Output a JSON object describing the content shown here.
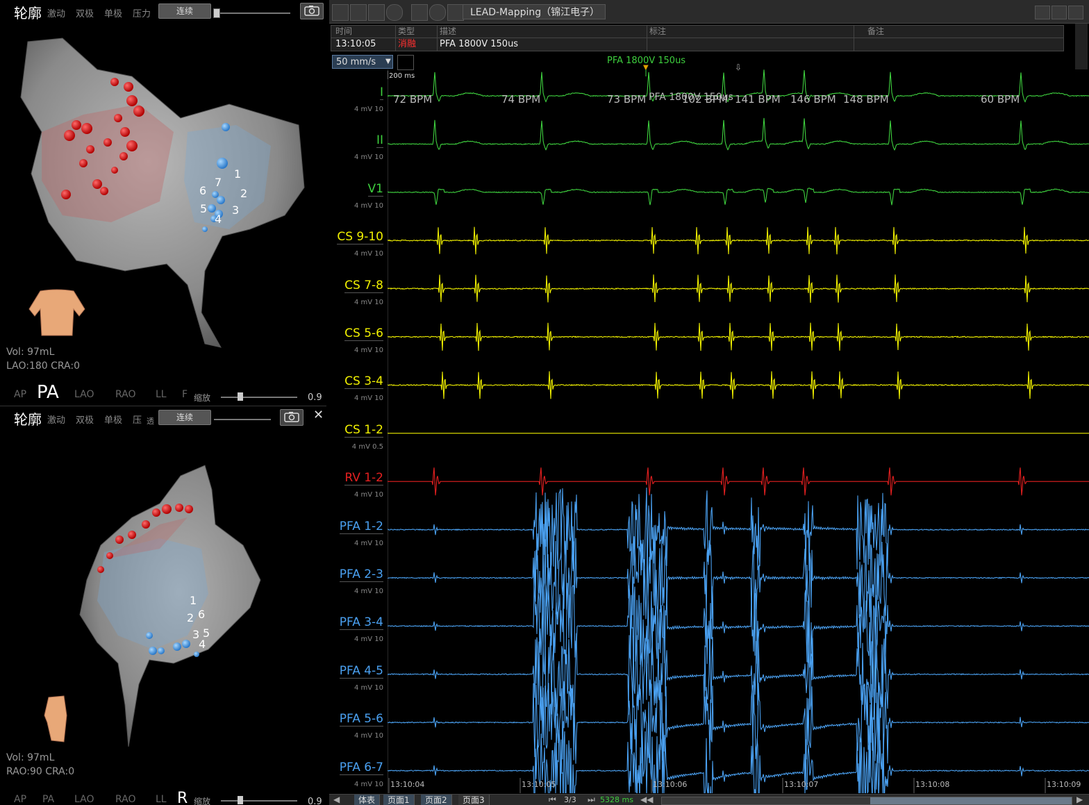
{
  "top_view": {
    "title": "轮廓",
    "options": [
      "激动",
      "双极",
      "单极",
      "压力"
    ],
    "mode_label": "连续",
    "vol": "Vol: 97mL",
    "orientation": "LAO:180 CRA:0",
    "views": [
      "AP",
      "PA",
      "LAO",
      "RAO",
      "LL",
      "F"
    ],
    "selected_view": "PA",
    "zoom_label": "缩放",
    "zoom_value": "0.9",
    "electrode_labels": [
      "1",
      "2",
      "3",
      "4",
      "5",
      "6",
      "7"
    ]
  },
  "bottom_view": {
    "title": "轮廓",
    "options": [
      "激动",
      "双极",
      "单极",
      "压",
      "透"
    ],
    "mode_label": "连续",
    "vol": "Vol: 97mL",
    "orientation": "RAO:90 CRA:0",
    "views": [
      "AP",
      "PA",
      "LAO",
      "RAO",
      "LL",
      "R"
    ],
    "selected_view": "R",
    "zoom_label": "缩放",
    "zoom_value": "0.9",
    "electrode_labels": [
      "1",
      "2",
      "6",
      "3",
      "5",
      "4"
    ]
  },
  "app": {
    "title": "LEAD-Mapping（锦江电子）"
  },
  "event_table": {
    "headers": [
      "时间",
      "类型",
      "描述",
      "标注",
      "备注"
    ],
    "row": {
      "time": "13:10:05",
      "type": "消融",
      "desc": "PFA 1800V 150us",
      "note": "",
      "remark": ""
    }
  },
  "speed": "50 mm/s",
  "scale_label": "200 ms",
  "marker_label": "PFA 1800V 150us",
  "marker_label_small": "PFA 1800V 150us",
  "bpm": [
    "72 BPM",
    "74 BPM",
    "73 BPM",
    "102 BPM",
    "141 BPM",
    "146 BPM",
    "148 BPM",
    "60 BPM"
  ],
  "channels": [
    {
      "name": "I",
      "scale": "4 mV 10",
      "color": "#3ecf3e"
    },
    {
      "name": "II",
      "scale": "4 mV 10",
      "color": "#3ecf3e"
    },
    {
      "name": "V1",
      "scale": "4 mV 10",
      "color": "#3ecf3e"
    },
    {
      "name": "CS 9-10",
      "scale": "4 mV 10",
      "color": "#f0f000"
    },
    {
      "name": "CS 7-8",
      "scale": "4 mV 10",
      "color": "#f0f000"
    },
    {
      "name": "CS 5-6",
      "scale": "4 mV 10",
      "color": "#f0f000"
    },
    {
      "name": "CS 3-4",
      "scale": "4 mV 10",
      "color": "#f0f000"
    },
    {
      "name": "CS 1-2",
      "scale": "4 mV 0.5",
      "color": "#f0f000"
    },
    {
      "name": "RV 1-2",
      "scale": "4 mV 10",
      "color": "#e62020"
    },
    {
      "name": "PFA 1-2",
      "scale": "4 mV 10",
      "color": "#4aa0f0"
    },
    {
      "name": "PFA 2-3",
      "scale": "4 mV 10",
      "color": "#4aa0f0"
    },
    {
      "name": "PFA 3-4",
      "scale": "4 mV 10",
      "color": "#4aa0f0"
    },
    {
      "name": "PFA 4-5",
      "scale": "4 mV 10",
      "color": "#4aa0f0"
    },
    {
      "name": "PFA 5-6",
      "scale": "4 mV 10",
      "color": "#4aa0f0"
    },
    {
      "name": "PFA 6-7",
      "scale": "4 mV 10",
      "color": "#4aa0f0"
    }
  ],
  "time_ticks": [
    "13:10:04",
    "13:10:05",
    "13:10:06",
    "13:10:07",
    "13:10:08",
    "13:10:09"
  ],
  "bottom": {
    "tabs": [
      "体表",
      "页面1",
      "页面2",
      "页面3"
    ],
    "page": "3/3",
    "duration": "5328 ms"
  }
}
